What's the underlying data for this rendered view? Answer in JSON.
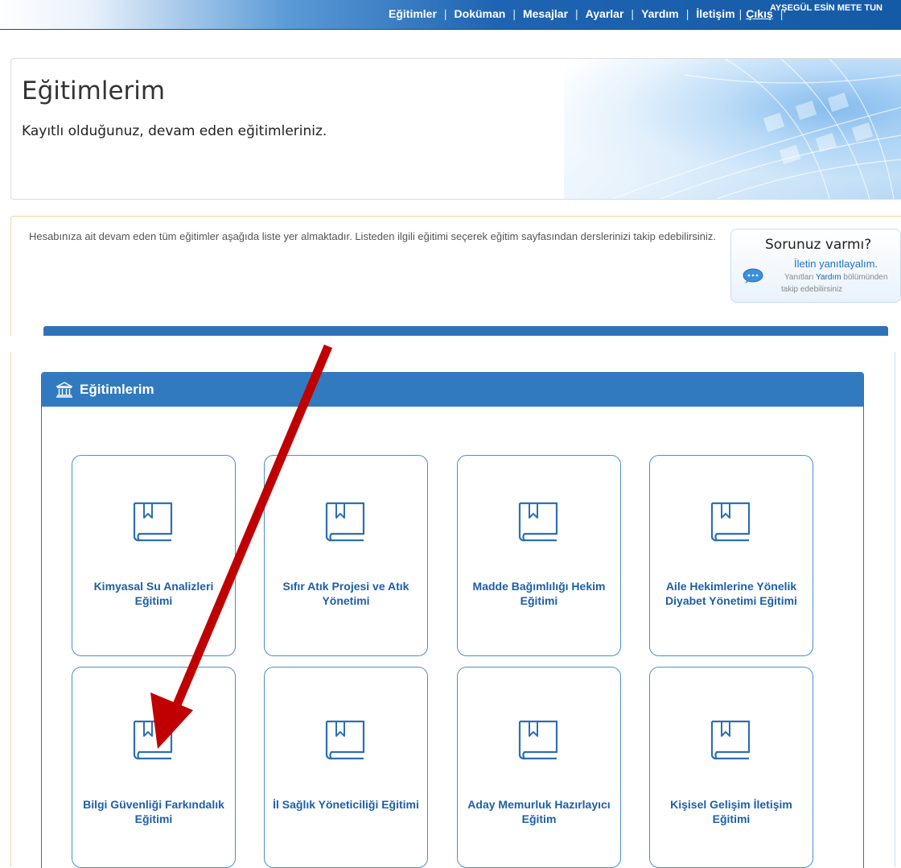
{
  "nav": {
    "items": [
      "Eğitimler",
      "Doküman",
      "Mesajlar",
      "Ayarlar",
      "Yardım",
      "İletişim",
      "Çıkış"
    ],
    "separator": "|",
    "user": "AYŞEGÜL ESİN  METE TUN"
  },
  "header": {
    "title": "Eğitimlerim",
    "subtitle": "Kayıtlı olduğunuz, devam eden eğitimleriniz."
  },
  "info": {
    "description": "Hesabınıza ait devam eden tüm eğitimler aşağıda liste yer almaktadır. Listeden ilgili eğitimi seçerek eğitim sayfasından derslerinizi takip edebilirsiniz."
  },
  "help": {
    "question": "Sorunuz varmı?",
    "answer": "İletin yanıtlayalım.",
    "note_before": "Yanıtları",
    "note_link": "Yardım",
    "note_after": "bölümünden",
    "note_line2": "takip edebilirsiniz"
  },
  "panel": {
    "title": "Eğitimlerim",
    "icon": "bank-icon"
  },
  "courses": [
    {
      "title": "Kimyasal Su Analizleri Eğitimi",
      "icon": "book-icon"
    },
    {
      "title": "Sıfır Atık Projesi ve Atık Yönetimi",
      "icon": "book-icon"
    },
    {
      "title": "Madde Bağımlılığı Hekim Eğitimi",
      "icon": "book-icon"
    },
    {
      "title": "Aile Hekimlerine Yönelik Diyabet Yönetimi Eğitimi",
      "icon": "book-icon"
    },
    {
      "title": "Bilgi Güvenliği Farkındalık Eğitimi",
      "icon": "book-icon"
    },
    {
      "title": "İl Sağlık Yöneticiliği Eğitimi",
      "icon": "book-icon"
    },
    {
      "title": "Aday Memurluk Hazırlayıcı Eğitim",
      "icon": "book-icon"
    },
    {
      "title": "Kişisel Gelişim İletişim Eğitimi",
      "icon": "book-icon"
    }
  ],
  "annotation": {
    "color": "#c00000",
    "target": "Bilgi Güvenliği Farkındalık Eğitimi"
  }
}
